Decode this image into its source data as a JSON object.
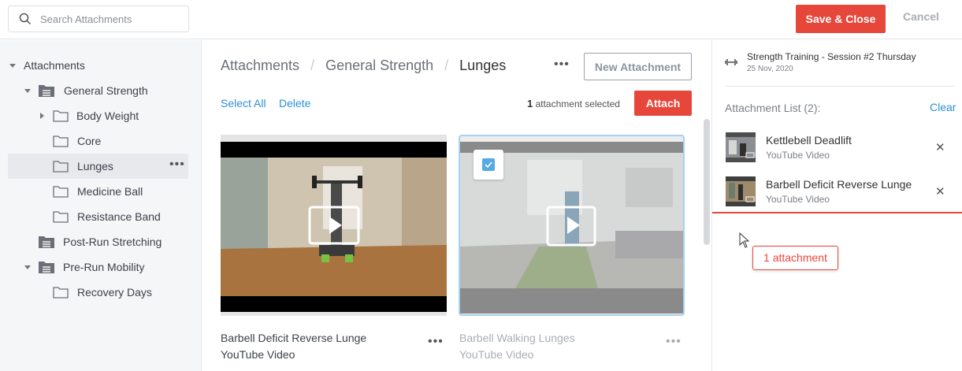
{
  "search": {
    "placeholder": "Search Attachments"
  },
  "header": {
    "save_label": "Save & Close",
    "cancel_label": "Cancel"
  },
  "sidebar": {
    "root": "Attachments",
    "items": [
      {
        "label": "General Strength",
        "type": "folder-group",
        "expanded": true
      },
      {
        "label": "Body Weight",
        "type": "folder",
        "expandable": true
      },
      {
        "label": "Core",
        "type": "folder"
      },
      {
        "label": "Lunges",
        "type": "folder",
        "active": true
      },
      {
        "label": "Medicine Ball",
        "type": "folder"
      },
      {
        "label": "Resistance Band",
        "type": "folder"
      },
      {
        "label": "Post-Run Stretching",
        "type": "folder-group"
      },
      {
        "label": "Pre-Run Mobility",
        "type": "folder-group",
        "expanded": true
      },
      {
        "label": "Recovery Days",
        "type": "folder"
      }
    ]
  },
  "main": {
    "breadcrumb": [
      "Attachments",
      "General Strength",
      "Lunges"
    ],
    "more_label": "•••",
    "new_attachment_label": "New Attachment",
    "select_all_label": "Select All",
    "delete_label": "Delete",
    "selected_count": "1",
    "selected_text": "attachment selected",
    "attach_label": "Attach",
    "cards": [
      {
        "title": "Barbell Deficit Reverse Lunge",
        "subtitle": "YouTube Video",
        "selected": false
      },
      {
        "title": "Barbell Walking Lunges",
        "subtitle": "YouTube Video",
        "selected": true
      }
    ]
  },
  "panel": {
    "session_title": "Strength Training - Session #2 Thursday",
    "session_date": "25 Nov, 2020",
    "list_heading": "Attachment List (2):",
    "clear_label": "Clear",
    "items": [
      {
        "name": "Kettlebell Deadlift",
        "subtitle": "YouTube Video"
      },
      {
        "name": "Barbell Deficit Reverse Lunge",
        "subtitle": "YouTube Video"
      }
    ],
    "drag_badge": "1 attachment"
  },
  "colors": {
    "accent": "#e6473a",
    "link": "#2b90d9",
    "sidebar_bg": "#f5f6f8"
  }
}
